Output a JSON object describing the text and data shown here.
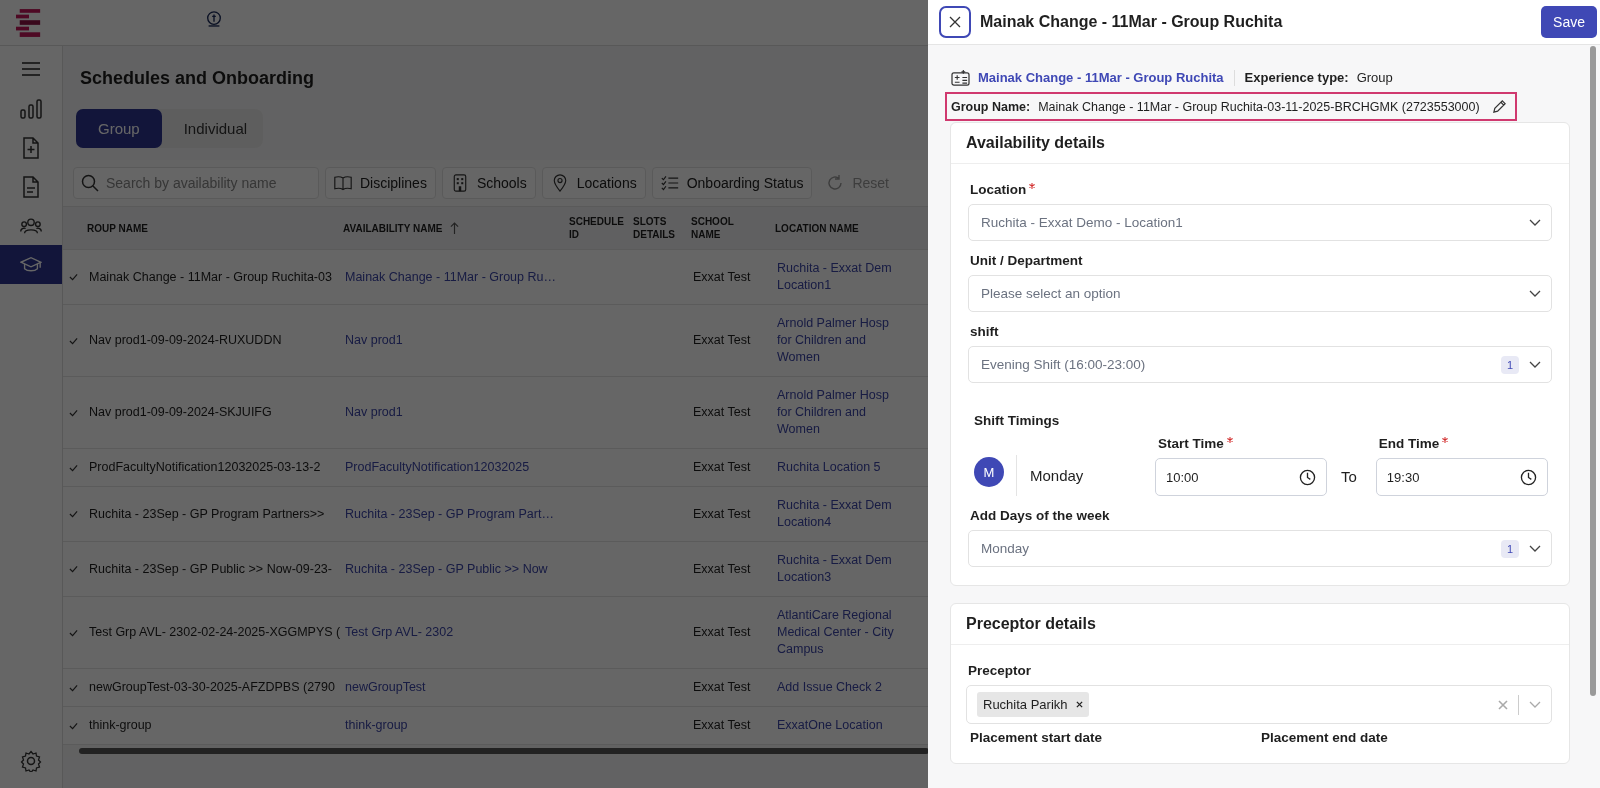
{
  "app": {
    "page_title": "Schedules and Onboarding"
  },
  "nav": [
    {
      "kind": "chart",
      "selected": false
    },
    {
      "kind": "file-plus",
      "selected": false
    },
    {
      "kind": "file",
      "selected": false
    },
    {
      "kind": "people",
      "selected": false
    },
    {
      "kind": "cap",
      "selected": true
    }
  ],
  "tabs": [
    {
      "label": "Group",
      "selected": true
    },
    {
      "label": "Individual",
      "selected": false
    }
  ],
  "search": {
    "placeholder": "Search by availability name"
  },
  "filters": [
    {
      "kind": "book",
      "label": "Disciplines"
    },
    {
      "kind": "building",
      "label": "Schools"
    },
    {
      "kind": "pin",
      "label": "Locations"
    },
    {
      "kind": "checklist",
      "label": "Onboarding Status"
    }
  ],
  "reset": {
    "label": "Reset",
    "disabled": true
  },
  "table": {
    "columns": [
      {
        "lines": [
          "ROUP NAME"
        ],
        "sorted": false
      },
      {
        "lines": [
          "AVAILABILITY NAME"
        ],
        "sorted": true
      },
      {
        "lines": [
          "SCHEDULE",
          "ID"
        ],
        "sorted": false
      },
      {
        "lines": [
          "SLOTS",
          "DETAILS"
        ],
        "sorted": false
      },
      {
        "lines": [
          "SCHOOL",
          "NAME"
        ],
        "sorted": false
      },
      {
        "lines": [
          "LOCATION NAME"
        ],
        "sorted": false
      }
    ],
    "rows": [
      {
        "checked": true,
        "group_name": "Mainak Change - 11Mar - Group Ruchita-03",
        "availability_name": "Mainak Change - 11Mar - Group Ru…",
        "school_name": "Exxat Test",
        "location": [
          "Ruchita - Exxat Dem",
          "Location1"
        ]
      },
      {
        "checked": true,
        "group_name": "Nav prod1-09-09-2024-RUXUDDN",
        "availability_name": "Nav prod1",
        "school_name": "Exxat Test",
        "location": [
          "Arnold Palmer Hosp",
          "for Children and",
          "Women"
        ]
      },
      {
        "checked": true,
        "group_name": "Nav prod1-09-09-2024-SKJUIFG",
        "availability_name": "Nav prod1",
        "school_name": "Exxat Test",
        "location": [
          "Arnold Palmer Hosp",
          "for Children and",
          "Women"
        ]
      },
      {
        "checked": true,
        "group_name": "ProdFacultyNotification12032025-03-13-2",
        "availability_name": "ProdFacultyNotification12032025",
        "school_name": "Exxat Test",
        "location": [
          "Ruchita Location 5"
        ]
      },
      {
        "checked": true,
        "group_name": "Ruchita - 23Sep - GP Program Partners>>",
        "availability_name": "Ruchita - 23Sep - GP Program Part…",
        "school_name": "Exxat Test",
        "location": [
          "Ruchita - Exxat Dem",
          "Location4"
        ]
      },
      {
        "checked": true,
        "group_name": "Ruchita - 23Sep - GP Public >> Now-09-23-",
        "availability_name": "Ruchita - 23Sep - GP Public >> Now",
        "school_name": "Exxat Test",
        "location": [
          "Ruchita - Exxat Dem",
          "Location3"
        ]
      },
      {
        "checked": true,
        "group_name": "Test Grp AVL- 2302-02-24-2025-XGGMPYS (",
        "availability_name": "Test Grp AVL- 2302",
        "school_name": "Exxat Test",
        "location": [
          "AtlantiCare Regional",
          "Medical Center - City",
          "Campus"
        ]
      },
      {
        "checked": true,
        "group_name": "newGroupTest-03-30-2025-AFZDPBS (2790",
        "availability_name": "newGroupTest",
        "school_name": "Exxat Test",
        "location": [
          "Add Issue Check 2"
        ]
      },
      {
        "checked": true,
        "group_name": "think-group",
        "availability_name": "think-group",
        "school_name": "Exxat Test",
        "location": [
          "ExxatOne Location"
        ]
      }
    ]
  },
  "panel": {
    "title": "Mainak Change - 11Mar - Group Ruchita",
    "save": "Save",
    "availability_link": "Mainak Change - 11Mar - Group Ruchita",
    "experience_label": "Experience type:",
    "experience_value": "Group",
    "group_name_label": "Group Name:",
    "group_name_value": "Mainak Change - 11Mar - Group Ruchita-03-11-2025-BRCHGMK (2723553000)"
  },
  "availability": {
    "title": "Availability details",
    "fields": [
      {
        "label": "Location",
        "required": true,
        "value": "Ruchita - Exxat Demo - Location1"
      },
      {
        "label": "Unit / Department",
        "required": false,
        "placeholder": "Please select an option"
      },
      {
        "label": "shift",
        "required": false,
        "value": "Evening Shift (16:00-23:00)",
        "count": "1"
      }
    ],
    "shift_timings": {
      "title": "Shift Timings",
      "day_initial": "M",
      "day": "Monday",
      "start_label": "Start Time",
      "start_required": true,
      "start": "10:00",
      "to": "To",
      "end_label": "End Time",
      "end_required": true,
      "end": "19:30"
    },
    "days": {
      "label": "Add Days of the week",
      "value": "Monday",
      "count": "1"
    }
  },
  "preceptor": {
    "title": "Preceptor details",
    "label": "Preceptor",
    "chips": [
      "Ruchita Parikh"
    ],
    "start_label": "Placement start date",
    "end_label": "Placement end date"
  }
}
